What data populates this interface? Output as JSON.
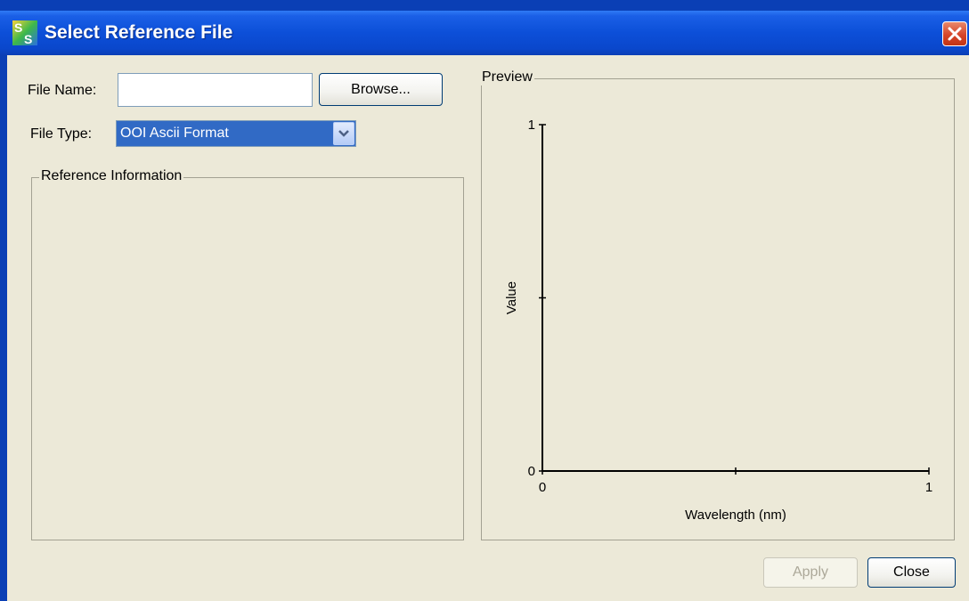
{
  "window": {
    "title": "Select Reference File",
    "app_icon_text": "SS",
    "colors": {
      "titlebar": "#0c4fd8",
      "client": "#ece9d8",
      "close": "#d6452a",
      "selection": "#316ac5"
    }
  },
  "form": {
    "file_name_label": "File Name:",
    "file_name_value": "",
    "browse_label": "Browse...",
    "file_type_label": "File Type:",
    "file_type_selected": "OOI Ascii Format"
  },
  "reference_info": {
    "title": "Reference Information"
  },
  "preview": {
    "title": "Preview"
  },
  "chart_data": {
    "type": "line",
    "series": [],
    "xlabel": "Wavelength (nm)",
    "ylabel": "Value",
    "xlim": [
      0,
      1
    ],
    "ylim": [
      0,
      1
    ],
    "x_ticks": [
      0,
      0.5,
      1
    ],
    "y_ticks": [
      0,
      0.5,
      1
    ],
    "x_tick_labels": [
      "0",
      "",
      "1"
    ],
    "y_tick_labels": [
      "0",
      "",
      "1"
    ],
    "grid": false
  },
  "footer": {
    "apply_label": "Apply",
    "close_label": "Close"
  }
}
